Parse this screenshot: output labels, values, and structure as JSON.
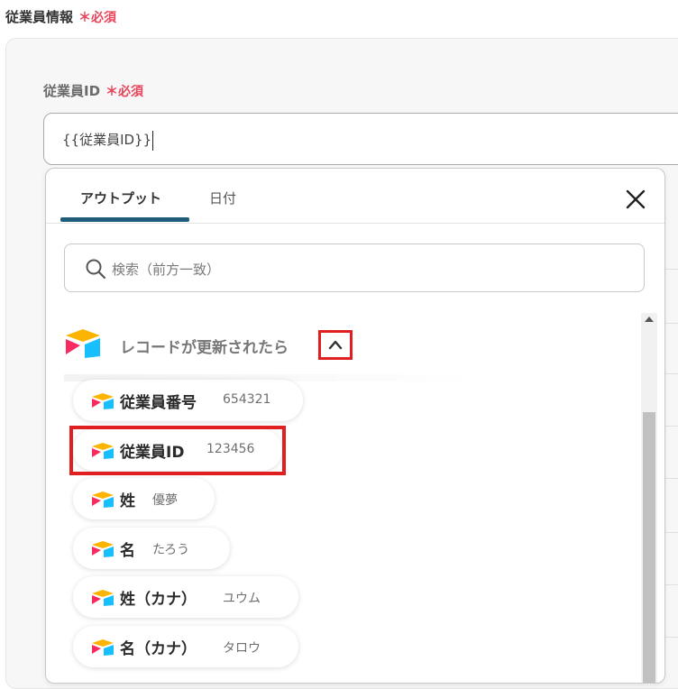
{
  "section": {
    "label": "従業員情報",
    "required": "＊必須"
  },
  "field": {
    "label": "従業員ID",
    "required": "＊必須",
    "value": "{{従業員ID}}"
  },
  "popup": {
    "tabs": [
      {
        "label": "アウトプット",
        "active": true
      },
      {
        "label": "日付",
        "active": false
      }
    ],
    "close_icon": "close-icon",
    "search": {
      "placeholder": "検索（前方一致）",
      "icon": "search-icon"
    },
    "group": {
      "title": "レコードが更新されたら",
      "toggle_icon": "chevron-up-icon",
      "logo_colors": [
        "#fcb400",
        "#18bfff",
        "#f82b60"
      ]
    },
    "items": [
      {
        "label": "従業員番号",
        "value": "654321"
      },
      {
        "label": "従業員ID",
        "value": "123456",
        "highlighted": true
      },
      {
        "label": "姓",
        "value": "優夢"
      },
      {
        "label": "名",
        "value": "たろう"
      },
      {
        "label": "姓（カナ）",
        "value": "ユウム"
      },
      {
        "label": "名（カナ）",
        "value": "タロウ"
      }
    ]
  },
  "colors": {
    "required": "#e8445a",
    "tab_accent": "#1f5d7a",
    "highlight_border": "#e02020"
  }
}
